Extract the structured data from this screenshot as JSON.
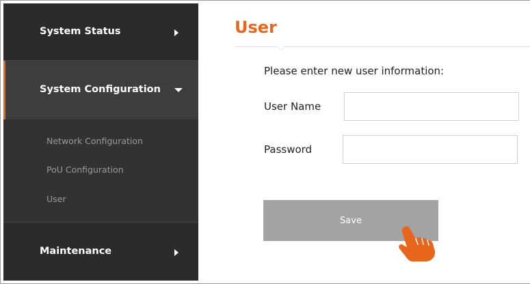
{
  "sidebar": {
    "system_status": "System Status",
    "system_configuration": "System Configuration",
    "sub_items": [
      "Network Configuration",
      "PoU Configuration",
      "User"
    ],
    "maintenance": "Maintenance"
  },
  "main": {
    "title": "User",
    "prompt": "Please enter new user information:",
    "username_label": "User Name",
    "username_value": "",
    "password_label": "Password",
    "password_value": "",
    "save_label": "Save"
  },
  "colors": {
    "accent": "#e8661c",
    "sidebar_bg": "#323232",
    "button_bg": "#a3a3a3"
  },
  "icons": {
    "pointer": "pointing-hand-icon"
  }
}
